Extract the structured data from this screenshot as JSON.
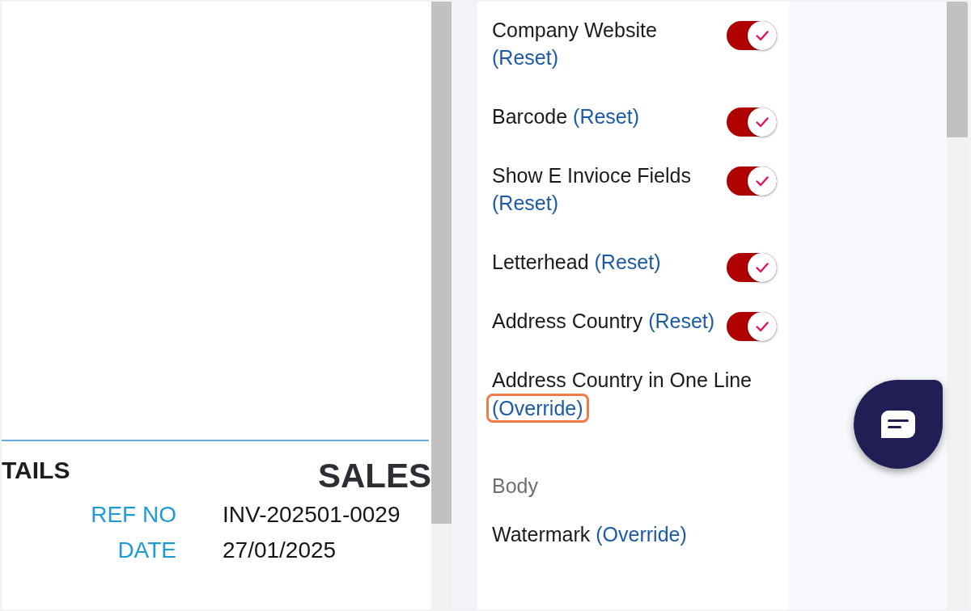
{
  "document_preview": {
    "heading": "TAILS",
    "title": "SALES",
    "fields": [
      {
        "label": "REF NO",
        "value": "INV-202501-0029"
      },
      {
        "label": "DATE",
        "value": "27/01/2025"
      }
    ]
  },
  "settings": {
    "groups": [
      {
        "items": [
          {
            "kind": "toggle",
            "label": "Company Website",
            "link": "(Reset)",
            "on": true,
            "highlighted": false
          },
          {
            "kind": "toggle",
            "label": "Barcode",
            "link": "(Reset)",
            "on": true,
            "highlighted": false
          },
          {
            "kind": "toggle",
            "label": "Show E Invioce Fields",
            "link": "(Reset)",
            "on": true,
            "highlighted": false
          },
          {
            "kind": "toggle",
            "label": "Letterhead",
            "link": "(Reset)",
            "on": true,
            "highlighted": false
          },
          {
            "kind": "toggle",
            "label": "Address Country",
            "link": "(Reset)",
            "on": true,
            "highlighted": false
          },
          {
            "kind": "plain",
            "label": "Address Country in One Line",
            "link": "(Override)",
            "highlighted": true
          }
        ]
      },
      {
        "heading": "Body",
        "items": [
          {
            "kind": "plain",
            "label": "Watermark",
            "link": "(Override)",
            "highlighted": false
          }
        ]
      }
    ]
  }
}
